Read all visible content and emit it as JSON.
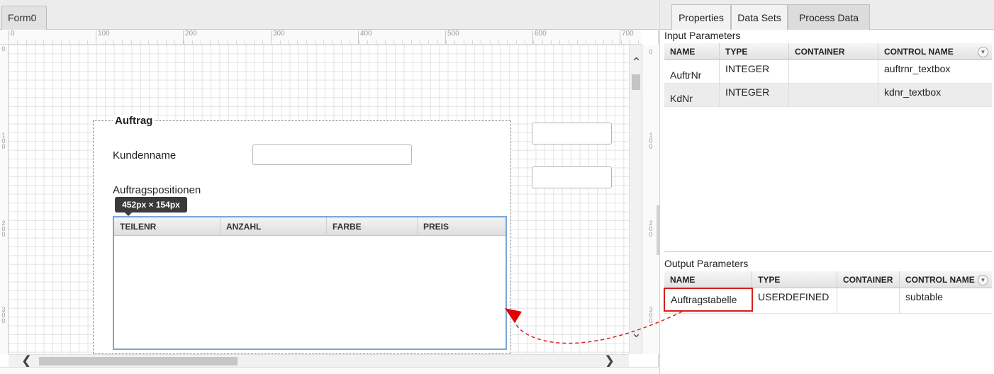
{
  "designer": {
    "form_tab": "Form0",
    "ruler_marks": [
      "0",
      "100",
      "200",
      "300",
      "400",
      "500",
      "600",
      "700"
    ],
    "groupbox_title": "Auftrag",
    "kundenname_label": "Kundenname",
    "positions_label": "Auftragspositionen",
    "size_tooltip": "452px × 154px",
    "subtable_columns": [
      "TEILENR",
      "ANZAHL",
      "FARBE",
      "PREIS"
    ]
  },
  "panel": {
    "tabs": [
      "Properties",
      "Data Sets",
      "Process Data"
    ],
    "input_title": "Input Parameters",
    "input_columns": [
      "NAME",
      "TYPE",
      "CONTAINER",
      "CONTROL NAME"
    ],
    "input_rows": [
      {
        "name": "AuftrNr",
        "type": "INTEGER",
        "container": "",
        "control": "auftrnr_textbox"
      },
      {
        "name": "KdNr",
        "type": "INTEGER",
        "container": "",
        "control": "kdnr_textbox"
      }
    ],
    "output_title": "Output Parameters",
    "output_columns": [
      "NAME",
      "TYPE",
      "CONTAINER",
      "CONTROL NAME"
    ],
    "output_rows": [
      {
        "name": "Auftragstabelle",
        "type": "USERDEFINED",
        "container": "",
        "control": "subtable"
      }
    ]
  },
  "colors": {
    "highlight": "#d81e1e",
    "selection_border": "#7aa6d8"
  }
}
